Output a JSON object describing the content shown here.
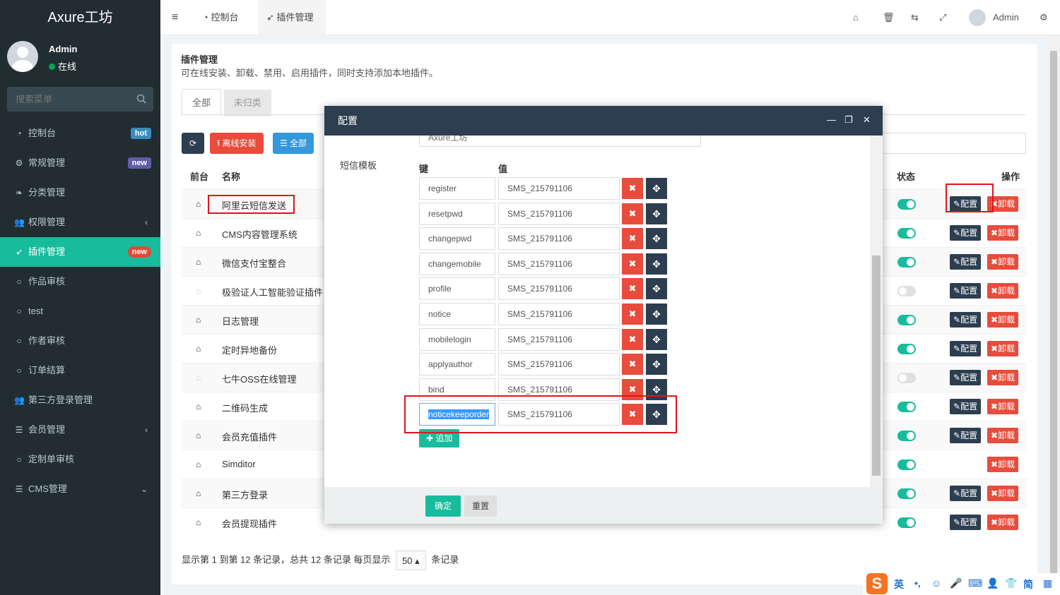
{
  "app": {
    "brand": "Axure工坊"
  },
  "user": {
    "name": "Admin",
    "status": "在线"
  },
  "sidebar": {
    "search_placeholder": "搜索菜单",
    "items": [
      {
        "label": "控制台",
        "icon": "dashboard-icon",
        "badge": "hot"
      },
      {
        "label": "常规管理",
        "icon": "cogs-icon",
        "badge": "new"
      },
      {
        "label": "分类管理",
        "icon": "leaf-icon"
      },
      {
        "label": "权限管理",
        "icon": "group-icon",
        "arrow": "‹"
      },
      {
        "label": "插件管理",
        "icon": "rocket-icon",
        "badge": "new",
        "active": true
      },
      {
        "label": "作品审核",
        "icon": "circle-icon"
      },
      {
        "label": "test",
        "icon": "circle-icon"
      },
      {
        "label": "作者审核",
        "icon": "circle-icon"
      },
      {
        "label": "订单结算",
        "icon": "circle-icon"
      },
      {
        "label": "第三方登录管理",
        "icon": "group-icon"
      },
      {
        "label": "会员管理",
        "icon": "list-icon",
        "arrow": "‹"
      },
      {
        "label": "定制单审核",
        "icon": "circle-icon"
      },
      {
        "label": "CMS管理",
        "icon": "list-icon",
        "arrow": "⌄"
      }
    ]
  },
  "topbar": {
    "tab1": "控制台",
    "tab2": "插件管理",
    "user": "Admin"
  },
  "page": {
    "title": "插件管理",
    "desc": "可在线安装、卸载、禁用、启用插件，同时支持添加本地插件。",
    "tabs": [
      "全部",
      "未归类"
    ],
    "buttons": {
      "offline": "离线安装",
      "all": "全部"
    },
    "headers": {
      "front": "前台",
      "name": "名称",
      "status": "状态",
      "ops": "操作"
    },
    "cfg_label": "配置",
    "del_label": "卸载",
    "rows": [
      {
        "name": "阿里云短信发送",
        "on": true,
        "home": true,
        "cfg": true
      },
      {
        "name": "CMS内容管理系统",
        "on": true,
        "home": true,
        "cfg": true
      },
      {
        "name": "微信支付宝整合",
        "on": true,
        "home": true,
        "cfg": true
      },
      {
        "name": "极验证人工智能验证插件",
        "on": false,
        "home": false,
        "cfg": true
      },
      {
        "name": "日志管理",
        "on": true,
        "home": true,
        "cfg": true
      },
      {
        "name": "定时异地备份",
        "on": true,
        "home": true,
        "cfg": true
      },
      {
        "name": "七牛OSS在线管理",
        "on": false,
        "home": false,
        "cfg": true
      },
      {
        "name": "二维码生成",
        "on": true,
        "home": true,
        "cfg": true
      },
      {
        "name": "会员充值插件",
        "on": true,
        "home": true,
        "cfg": true
      },
      {
        "name": "Simditor",
        "on": true,
        "home": true,
        "cfg": false
      },
      {
        "name": "第三方登录",
        "on": true,
        "home": true,
        "cfg": true
      },
      {
        "name": "会员提现插件",
        "on": true,
        "home": true,
        "cfg": true
      }
    ],
    "footer": {
      "prefix": "显示第 1 到第 12 条记录，总共 12 条记录 每页显示",
      "per_page": "50",
      "suffix": "条记录"
    }
  },
  "modal": {
    "title": "配置",
    "prev_value": "Axure工坊",
    "section_label": "短信模板",
    "key_header": "键",
    "value_header": "值",
    "rows": [
      {
        "key": "register",
        "value": "SMS_215791106"
      },
      {
        "key": "resetpwd",
        "value": "SMS_215791106"
      },
      {
        "key": "changepwd",
        "value": "SMS_215791106"
      },
      {
        "key": "changemobile",
        "value": "SMS_215791106"
      },
      {
        "key": "profile",
        "value": "SMS_215791106"
      },
      {
        "key": "notice",
        "value": "SMS_215791106"
      },
      {
        "key": "mobilelogin",
        "value": "SMS_215791106"
      },
      {
        "key": "applyauthor",
        "value": "SMS_215791106"
      },
      {
        "key": "bind",
        "value": "SMS_215791106"
      },
      {
        "key": "noticekeeporder",
        "value": "SMS_215791106",
        "focused": true
      }
    ],
    "add_label": "追加",
    "ok_label": "确定",
    "reset_label": "重置"
  },
  "ime": {
    "lang": "英",
    "simp": "简"
  },
  "colors": {
    "sidebar": "#222d32",
    "accent": "#18bc9c",
    "danger": "#e74c3c",
    "dark": "#2c3e50",
    "info": "#3498db"
  }
}
